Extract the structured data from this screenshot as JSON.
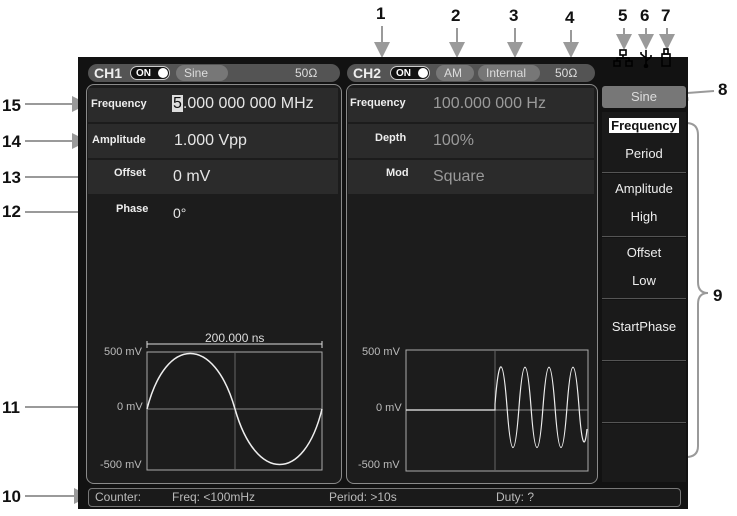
{
  "callouts": {
    "n1": "1",
    "n2": "2",
    "n3": "3",
    "n4": "4",
    "n5": "5",
    "n6": "6",
    "n7": "7",
    "n8": "8",
    "n9": "9",
    "n10": "10",
    "n11": "11",
    "n12": "12",
    "n13": "13",
    "n14": "14",
    "n15": "15"
  },
  "status_icons": {
    "network": "network-icon",
    "usb": "usb-icon",
    "storage": "usb-drive-icon"
  },
  "ch1": {
    "name": "CH1",
    "toggle": "ON",
    "waveform": "Sine",
    "impedance": "50Ω",
    "params": [
      {
        "label": "Frequency",
        "cursor_digit": "5",
        "value": ".000 000 000 MHz"
      },
      {
        "label": "Amplitude",
        "value": "1.000 Vpp"
      },
      {
        "label": "Offset",
        "value": "0 mV"
      },
      {
        "label": "Phase",
        "value": "0°"
      }
    ],
    "plot": {
      "period_label": "200.000 ns",
      "y_labels": [
        "500 mV",
        "0 mV",
        "-500 mV"
      ]
    }
  },
  "ch2": {
    "name": "CH2",
    "toggle": "ON",
    "mod_type": "AM",
    "source": "Internal",
    "impedance": "50Ω",
    "params": [
      {
        "label": "Frequency",
        "value": "100.000 000 Hz"
      },
      {
        "label": "Depth",
        "value": "100%"
      },
      {
        "label": "Mod",
        "value": "Square"
      }
    ],
    "plot": {
      "y_labels": [
        "500 mV",
        "0 mV",
        "-500 mV"
      ]
    }
  },
  "menu": {
    "title": "Sine",
    "items": [
      {
        "top": "Frequency",
        "bottom": "Period"
      },
      {
        "top": "Amplitude",
        "bottom": "High"
      },
      {
        "top": "Offset",
        "bottom": "Low"
      },
      {
        "top": "StartPhase",
        "bottom": ""
      },
      {
        "top": "",
        "bottom": ""
      },
      {
        "top": "",
        "bottom": ""
      }
    ]
  },
  "counter": {
    "label": "Counter:",
    "freq": "Freq: <100mHz",
    "period": "Period: >10s",
    "duty": "Duty: ?"
  },
  "colors": {
    "screen": "#121212",
    "panel": "#1c1c1c",
    "text": "#e6e6e6",
    "dim": "#9a9a9a"
  }
}
